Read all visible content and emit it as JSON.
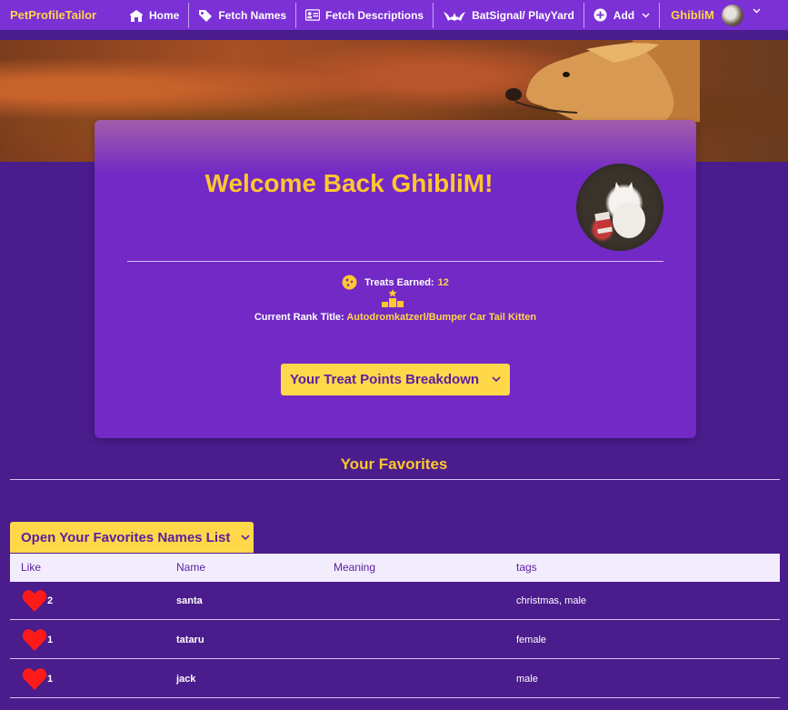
{
  "nav": {
    "brand": "PetProfileTailor",
    "items": [
      {
        "label": "Home",
        "icon": "home-icon"
      },
      {
        "label": "Fetch Names",
        "icon": "tag-icon"
      },
      {
        "label": "Fetch Descriptions",
        "icon": "id-card-icon"
      },
      {
        "label": "BatSignal/ PlayYard",
        "icon": "bat-icon"
      },
      {
        "label": "Add",
        "icon": "plus-circle-icon"
      }
    ],
    "username": "GhibliM"
  },
  "profile": {
    "welcome": "Welcome Back GhibliM!",
    "treats_label": "Treats Earned:",
    "treats_value": "12",
    "rank_label": "Current Rank Title:",
    "rank_value": "Autodromkatzerl/Bumper Car Tail Kitten",
    "breakdown_button": "Your Treat Points Breakdown"
  },
  "favorites": {
    "title": "Your Favorites",
    "open_button": "Open Your Favorites Names List",
    "columns": [
      "Like",
      "Name",
      "Meaning",
      "tags"
    ],
    "rows": [
      {
        "likes": "2",
        "name": "santa",
        "meaning": "",
        "tags": "christmas, male"
      },
      {
        "likes": "1",
        "name": "tataru",
        "meaning": "",
        "tags": "female"
      },
      {
        "likes": "1",
        "name": "jack",
        "meaning": "",
        "tags": "male"
      }
    ]
  },
  "colors": {
    "nav_bg": "#7b31d6",
    "page_bg": "#4a1c8c",
    "card_bg": "#7229c5",
    "accent": "#ffd54a",
    "heart": "#ff1a1a"
  }
}
